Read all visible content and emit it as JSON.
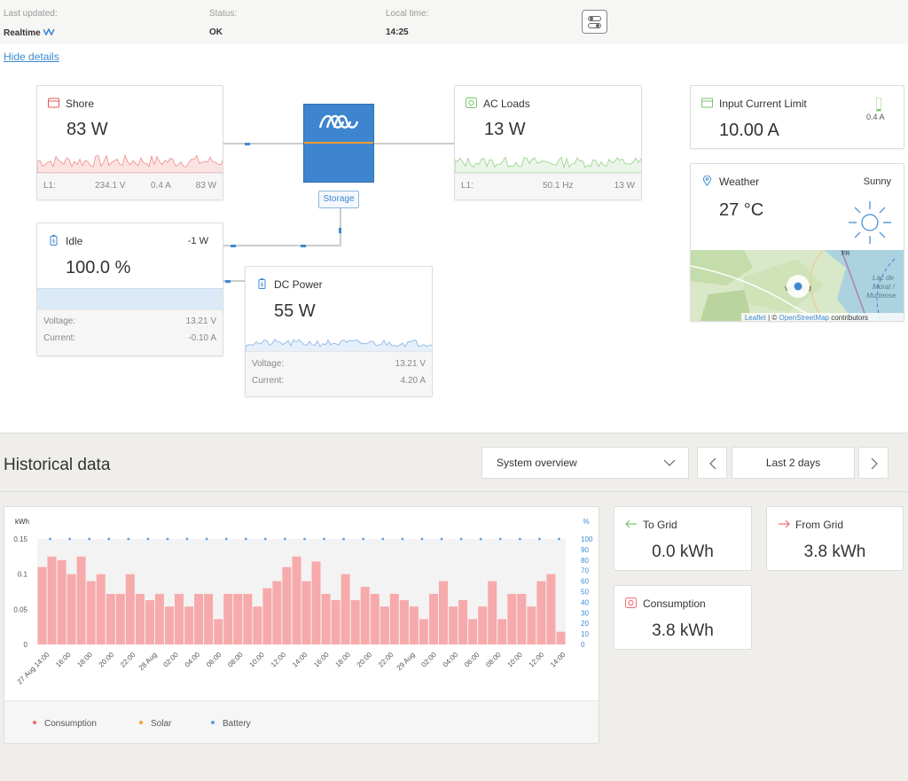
{
  "status_bar": {
    "last_updated_label": "Last updated:",
    "last_updated_value": "Realtime",
    "status_label": "Status:",
    "status_value": "OK",
    "local_time_label": "Local time:",
    "local_time_value": "14:25"
  },
  "hide_details": "Hide details",
  "shore": {
    "title": "Shore",
    "power": "83 W",
    "footer_label": "L1:",
    "voltage": "234.1 V",
    "current": "0.4 A",
    "footer_power": "83 W",
    "color": "#e8585a"
  },
  "ac_loads": {
    "title": "AC Loads",
    "power": "13 W",
    "footer_label": "L1:",
    "frequency": "50.1 Hz",
    "footer_power": "13 W",
    "color": "#79c36d"
  },
  "input_current_limit": {
    "title": "Input Current Limit",
    "value": "10.00 A",
    "indicator": "0.4 A"
  },
  "weather": {
    "title": "Weather",
    "condition": "Sunny",
    "temperature": "27 °C",
    "map_attribution_leaflet": "Leaflet",
    "map_attribution_sep": " | © ",
    "map_attribution_osm": "OpenStreetMap",
    "map_attribution_rest": " contributors",
    "map_labels": [
      "Lac de",
      "Morat /",
      "Murtense",
      "FR",
      "Va",
      "and"
    ]
  },
  "inverter": {
    "mode": "Storage",
    "color": "#3e85cf"
  },
  "battery": {
    "title": "Idle",
    "power": "-1 W",
    "soc": "100.0 %",
    "soc_fraction": 1.0,
    "voltage_label": "Voltage:",
    "voltage": "13.21 V",
    "current_label": "Current:",
    "current": "-0.10 A"
  },
  "dc_power": {
    "title": "DC Power",
    "power": "55 W",
    "voltage_label": "Voltage:",
    "voltage": "13.21 V",
    "current_label": "Current:",
    "current": "4.20 A"
  },
  "historical": {
    "title": "Historical data",
    "selected_view": "System overview",
    "range": "Last 2 days"
  },
  "stats": {
    "to_grid_label": "To Grid",
    "to_grid_value": "0.0 kWh",
    "from_grid_label": "From Grid",
    "from_grid_value": "3.8 kWh",
    "consumption_label": "Consumption",
    "consumption_value": "3.8 kWh"
  },
  "legend": [
    "Consumption",
    "Solar",
    "Battery"
  ],
  "chart_data": {
    "type": "bar",
    "ylabel": "kWh",
    "y2label": "%",
    "ylim": [
      0,
      0.15
    ],
    "y2lim": [
      0,
      100
    ],
    "yticks": [
      "0",
      "0.05",
      "0.1",
      "0.15"
    ],
    "y2ticks": [
      "0",
      "10",
      "20",
      "30",
      "40",
      "50",
      "60",
      "70",
      "80",
      "90",
      "100"
    ],
    "xticks": [
      "27 Aug 14:00",
      "16:00",
      "18:00",
      "20:00",
      "22:00",
      "28 Aug",
      "02:00",
      "04:00",
      "06:00",
      "08:00",
      "10:00",
      "12:00",
      "14:00",
      "16:00",
      "18:00",
      "20:00",
      "22:00",
      "29 Aug",
      "02:00",
      "04:00",
      "06:00",
      "08:00",
      "10:00",
      "12:00",
      "14:00"
    ],
    "series": [
      {
        "name": "Consumption",
        "color": "#f7aaab",
        "axis": "left",
        "values": [
          0.11,
          0.125,
          0.12,
          0.1,
          0.125,
          0.09,
          0.1,
          0.072,
          0.072,
          0.1,
          0.072,
          0.063,
          0.072,
          0.054,
          0.072,
          0.054,
          0.072,
          0.072,
          0.036,
          0.072,
          0.072,
          0.072,
          0.054,
          0.08,
          0.09,
          0.11,
          0.125,
          0.09,
          0.118,
          0.072,
          0.063,
          0.1,
          0.063,
          0.082,
          0.072,
          0.054,
          0.072,
          0.063,
          0.054,
          0.036,
          0.072,
          0.09,
          0.054,
          0.063,
          0.036,
          0.054,
          0.09,
          0.036,
          0.072,
          0.072,
          0.054,
          0.09,
          0.1,
          0.018
        ]
      },
      {
        "name": "Battery",
        "color": "#5aa0e0",
        "axis": "right",
        "values": [
          100,
          100,
          100,
          100,
          100,
          100,
          100,
          100,
          100,
          100,
          100,
          100,
          100,
          100,
          100,
          100,
          100,
          100,
          100,
          100,
          100,
          100,
          100,
          100,
          100,
          100,
          100,
          100,
          100,
          100,
          100,
          100,
          100,
          100,
          100,
          100,
          100,
          100,
          100,
          100,
          100,
          100,
          100,
          100,
          100,
          100,
          100,
          100,
          100,
          100,
          100,
          100,
          100,
          100
        ]
      }
    ],
    "legend": [
      "Consumption",
      "Solar",
      "Battery"
    ],
    "grid": false
  }
}
